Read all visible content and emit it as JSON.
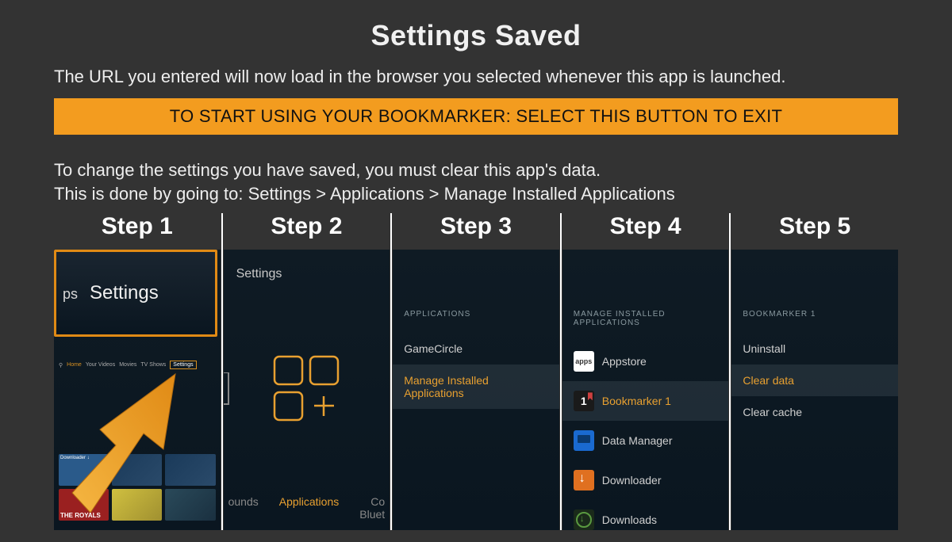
{
  "title": "Settings Saved",
  "subtitle": "The URL you entered will now load in the browser you selected whenever this app is launched.",
  "exit_button": "TO START USING YOUR BOOKMARKER: SELECT THIS BUTTON TO EXIT",
  "instruction1": "To change the settings you have saved, you must clear this app's data.",
  "instruction2": "This is done by going to: Settings > Applications > Manage Installed Applications",
  "steps": {
    "s1": {
      "heading": "Step 1",
      "focus_prefix": "ps",
      "focus_label": "Settings",
      "nav": {
        "home": "Home",
        "items": [
          "Your Videos",
          "Movies",
          "TV Shows"
        ],
        "boxed": "Settings"
      },
      "search_icon": "search-icon",
      "download_label": "Downloader",
      "royals": "THE ROYALS"
    },
    "s2": {
      "heading": "Step 2",
      "header": "Settings",
      "bottom": {
        "left": "ounds",
        "mid": "Applications",
        "right_l1": "Co",
        "right_l2": "Bluet"
      }
    },
    "s3": {
      "heading": "Step 3",
      "section": "APPLICATIONS",
      "items": [
        {
          "label": "GameCircle",
          "hl": false
        },
        {
          "label": "Manage Installed Applications",
          "hl": true
        }
      ]
    },
    "s4": {
      "heading": "Step 4",
      "section": "MANAGE INSTALLED APPLICATIONS",
      "items": [
        {
          "label": "Appstore",
          "icon": "apps",
          "icon_text": "apps",
          "hl": false
        },
        {
          "label": "Bookmarker 1",
          "icon": "bm",
          "icon_text": "1",
          "hl": true
        },
        {
          "label": "Data Manager",
          "icon": "dm",
          "icon_text": "",
          "hl": false
        },
        {
          "label": "Downloader",
          "icon": "dl2",
          "icon_text": "",
          "hl": false
        },
        {
          "label": "Downloads",
          "icon": "dls",
          "icon_text": "",
          "hl": false
        }
      ]
    },
    "s5": {
      "heading": "Step 5",
      "section": "BOOKMARKER 1",
      "items": [
        {
          "label": "Uninstall",
          "hl": false
        },
        {
          "label": "Clear data",
          "hl": true
        },
        {
          "label": "Clear cache",
          "hl": false
        }
      ]
    }
  }
}
